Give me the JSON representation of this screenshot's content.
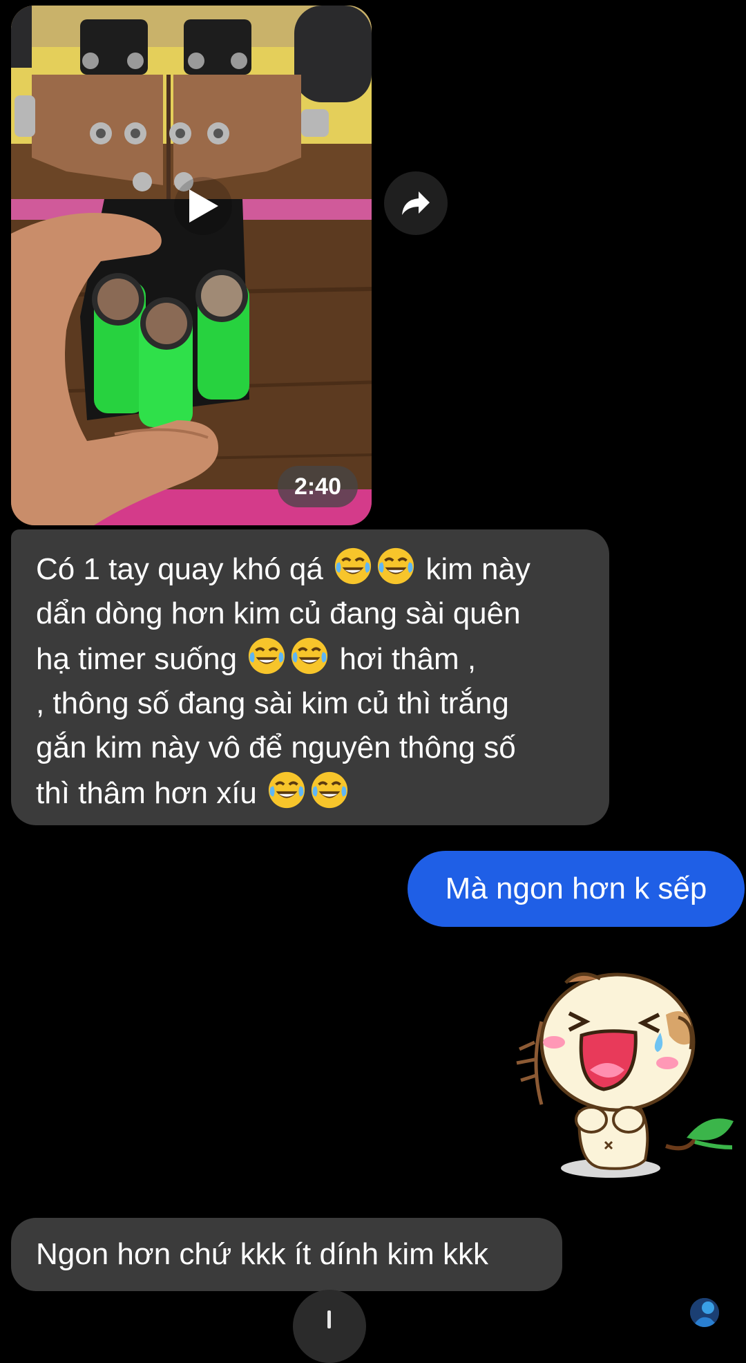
{
  "thread": {
    "video_message": {
      "duration": "2:40"
    },
    "messages": [
      {
        "line_1_a": "Có 1 tay quay khó qá",
        "line_1_b": "kim này",
        "line_2": "dẩn dòng hơn kim củ đang sài quên",
        "line_3_a": "hạ timer suống",
        "line_3_b": "hơi thâm ,",
        "line_4": ", thông số đang sài kim củ thì trắng",
        "line_5": "gắn kim này vô để nguyên thông số",
        "line_6": "thì thâm hơn xíu"
      },
      {
        "text": "Mà ngon hơn k sếp"
      },
      {
        "text": "Ngon hơn chứ kkk ít dính kim kkk"
      }
    ],
    "emoji": "face-with-tears-of-joy",
    "sticker": "laughing-dog-sticker",
    "colors": {
      "background": "#000000",
      "incoming_bubble": "#3b3b3b",
      "outgoing_bubble": "#1f5fe6"
    }
  }
}
